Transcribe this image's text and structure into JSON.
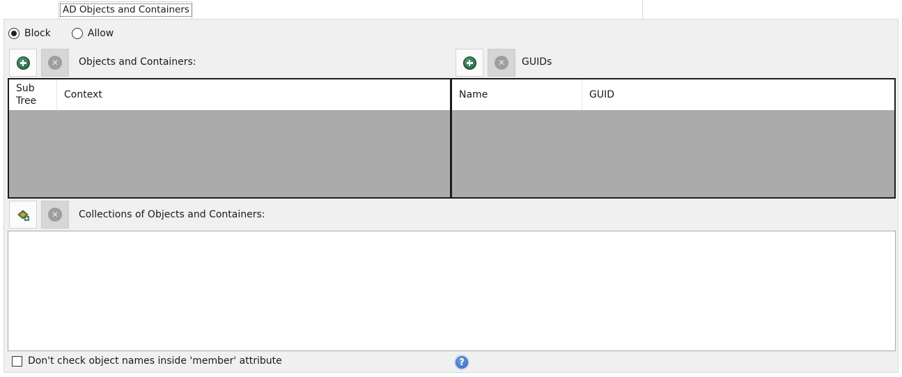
{
  "tabs": [
    {
      "label": "AD Objects and Containers",
      "active": true
    }
  ],
  "mode": {
    "options": [
      "Block",
      "Allow"
    ],
    "selected": "Block"
  },
  "objects_section": {
    "label": "Objects and Containers:",
    "columns": [
      "Sub Tree",
      "Context"
    ],
    "rows": []
  },
  "guids_section": {
    "label": "GUIDs",
    "columns": [
      "Name",
      "GUID"
    ],
    "rows": []
  },
  "collections_section": {
    "label": "Collections of Objects and Containers:",
    "items": []
  },
  "member_check": {
    "label": "Don't check object names inside 'member' attribute",
    "checked": false
  },
  "icons": {
    "add": "add-icon",
    "remove": "remove-icon",
    "collection_add": "collection-add-icon",
    "help": "help-icon"
  },
  "colors": {
    "add_icon": "#2e7a4f",
    "grid_empty": "#ababab",
    "panel_bg": "#f0f0f0"
  }
}
